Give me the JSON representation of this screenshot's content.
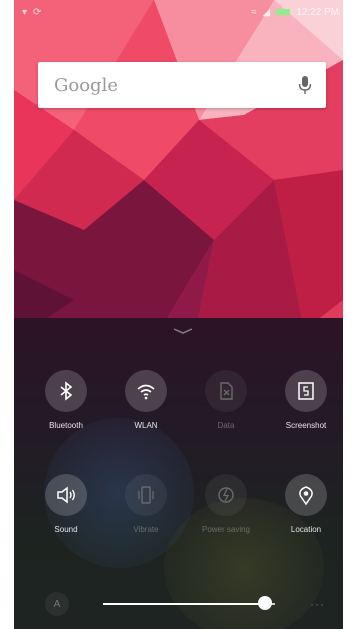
{
  "status_bar": {
    "left_icons": [
      "notification-icon",
      "sync-icon"
    ],
    "right_icons": [
      "wifi-icon",
      "signal-icon",
      "battery-icon"
    ],
    "time": "12:22 PM"
  },
  "search_widget": {
    "label": "Google",
    "mic_icon": "mic-icon"
  },
  "control_panel": {
    "tiles": [
      {
        "label": "Bluetooth",
        "icon": "bluetooth-icon",
        "on": true
      },
      {
        "label": "WLAN",
        "icon": "wifi-icon",
        "on": true
      },
      {
        "label": "Data",
        "icon": "sim-card-icon",
        "on": false
      },
      {
        "label": "Screenshot",
        "icon": "screenshot-icon",
        "on": true
      },
      {
        "label": "Sound",
        "icon": "sound-icon",
        "on": true
      },
      {
        "label": "Vibrate",
        "icon": "vibrate-icon",
        "on": false
      },
      {
        "label": "Power saving",
        "icon": "power-icon",
        "on": false
      },
      {
        "label": "Location",
        "icon": "location-icon",
        "on": true
      }
    ],
    "brightness_level": 0.94,
    "brightness_auto_label": "A",
    "more_label": "···"
  }
}
